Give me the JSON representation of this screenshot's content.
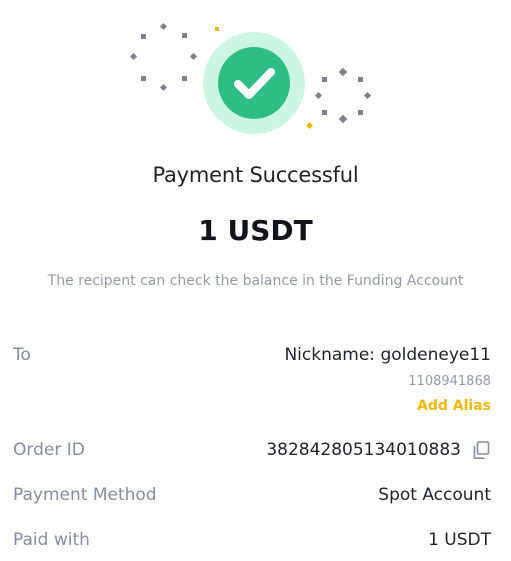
{
  "status": {
    "title": "Payment Successful",
    "amount": "1 USDT",
    "note": "The recipent can check the balance in the Funding Account",
    "icon": "checkmark-icon",
    "colors": {
      "success": "#2ebd85",
      "success_halo": "#cdf6e2",
      "accent": "#f0b90b",
      "confetti": "#7c828c"
    }
  },
  "details": {
    "to": {
      "label": "To",
      "nickname": "Nickname: goldeneye11",
      "user_id": "1108941868",
      "add_alias": "Add Alias"
    },
    "order_id": {
      "label": "Order ID",
      "value": "382842805134010883",
      "icon": "copy-icon"
    },
    "payment_method": {
      "label": "Payment Method",
      "value": "Spot Account"
    },
    "paid_with": {
      "label": "Paid with",
      "value": "1 USDT"
    }
  }
}
